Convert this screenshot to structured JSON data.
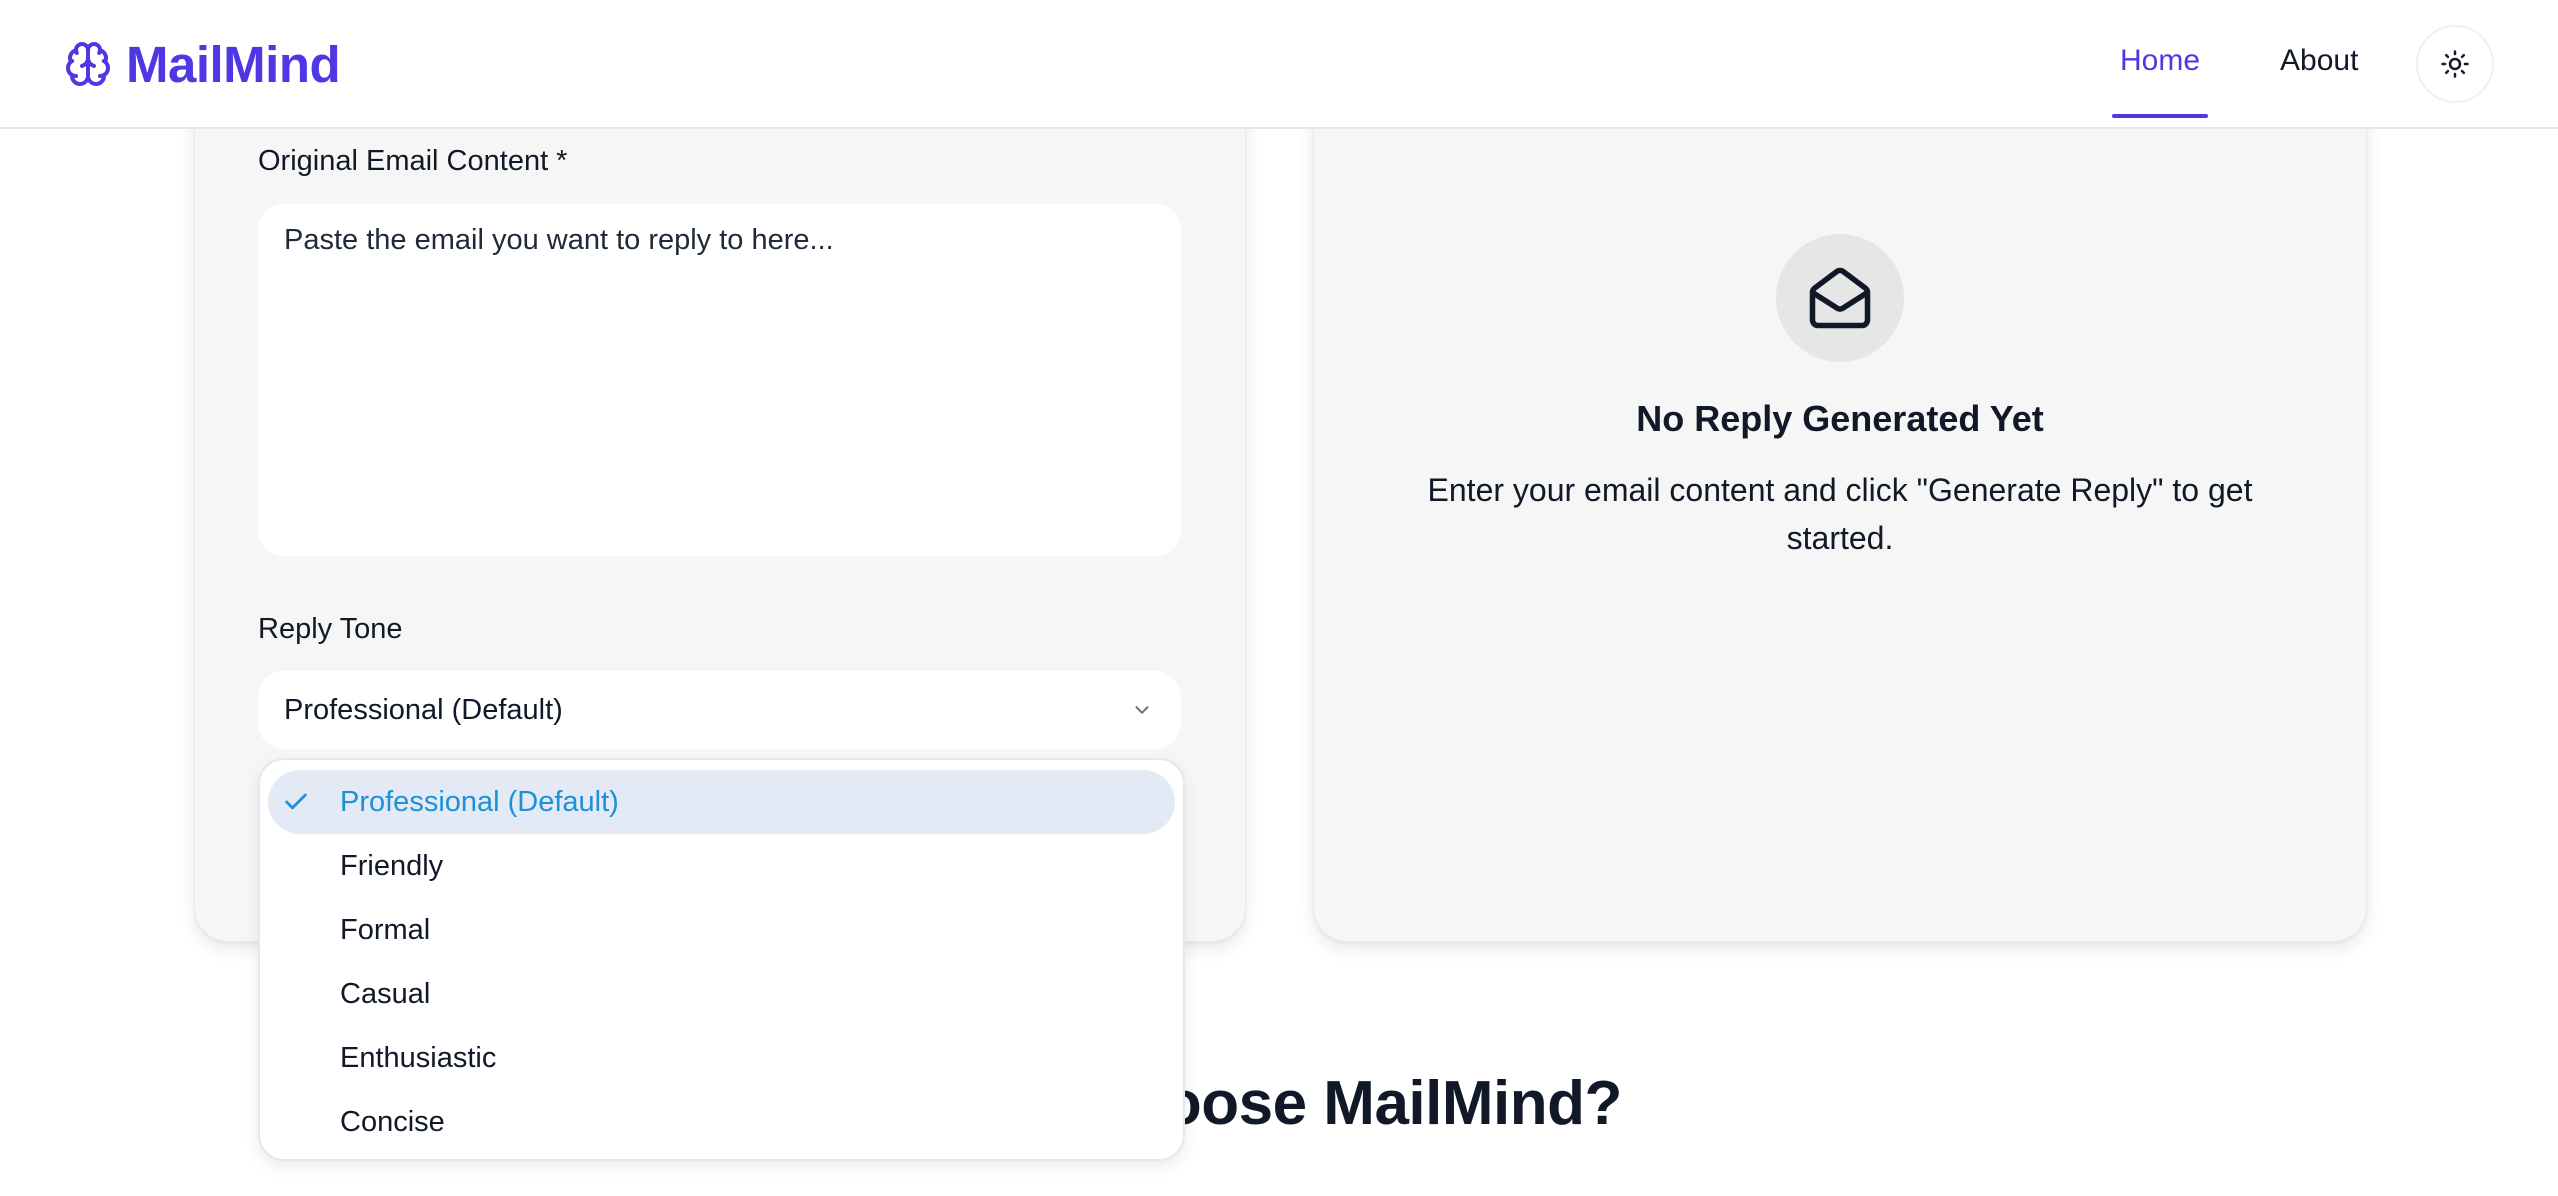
{
  "header": {
    "brand_name": "MailMind",
    "nav": {
      "home": "Home",
      "about": "About"
    },
    "active_nav": "Home",
    "theme_toggle_icon": "sun-icon"
  },
  "form": {
    "email_label": "Original Email Content *",
    "email_placeholder": "Paste the email you want to reply to here...",
    "email_value": "",
    "tone_label": "Reply Tone",
    "tone_selected": "Professional (Default)",
    "tone_options": [
      "Professional (Default)",
      "Friendly",
      "Formal",
      "Casual",
      "Enthusiastic",
      "Concise"
    ]
  },
  "empty_state": {
    "icon": "mail-open-icon",
    "title": "No Reply Generated Yet",
    "description": "Enter your email content and click \"Generate Reply\" to get started."
  },
  "section": {
    "heading": "Why Choose MailMind?"
  },
  "colors": {
    "brand": "#4f38e3",
    "selected_option_text": "#1e90d6",
    "selected_option_bg": "#e3eaf5",
    "card_bg": "#f5f6f5"
  }
}
